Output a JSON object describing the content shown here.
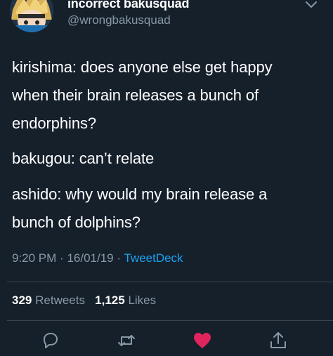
{
  "header": {
    "display_name": "incorrect bakusquad",
    "handle": "@wrongbakusquad"
  },
  "tweet": {
    "lines": [
      "kirishima: does anyone else get happy",
      "when their brain releases a bunch of",
      "endorphins?",
      "bakugou: can’t relate",
      "ashido: why would my brain release a",
      "bunch of dolphins?"
    ],
    "time": "9:20 PM",
    "date": "16/01/19",
    "separator": "·",
    "source": "TweetDeck"
  },
  "stats": {
    "retweets_count": "329",
    "retweets_label": "Retweets",
    "likes_count": "1,125",
    "likes_label": "Likes"
  },
  "actions": {
    "icons": [
      "reply-icon",
      "retweet-icon",
      "like-icon",
      "share-icon"
    ],
    "like_color": "#e0245e",
    "icon_color": "#8899a6"
  },
  "colors": {
    "background": "#15202b",
    "secondary_text": "#8899a6",
    "link": "#1da1f2",
    "divider": "#38444d"
  }
}
